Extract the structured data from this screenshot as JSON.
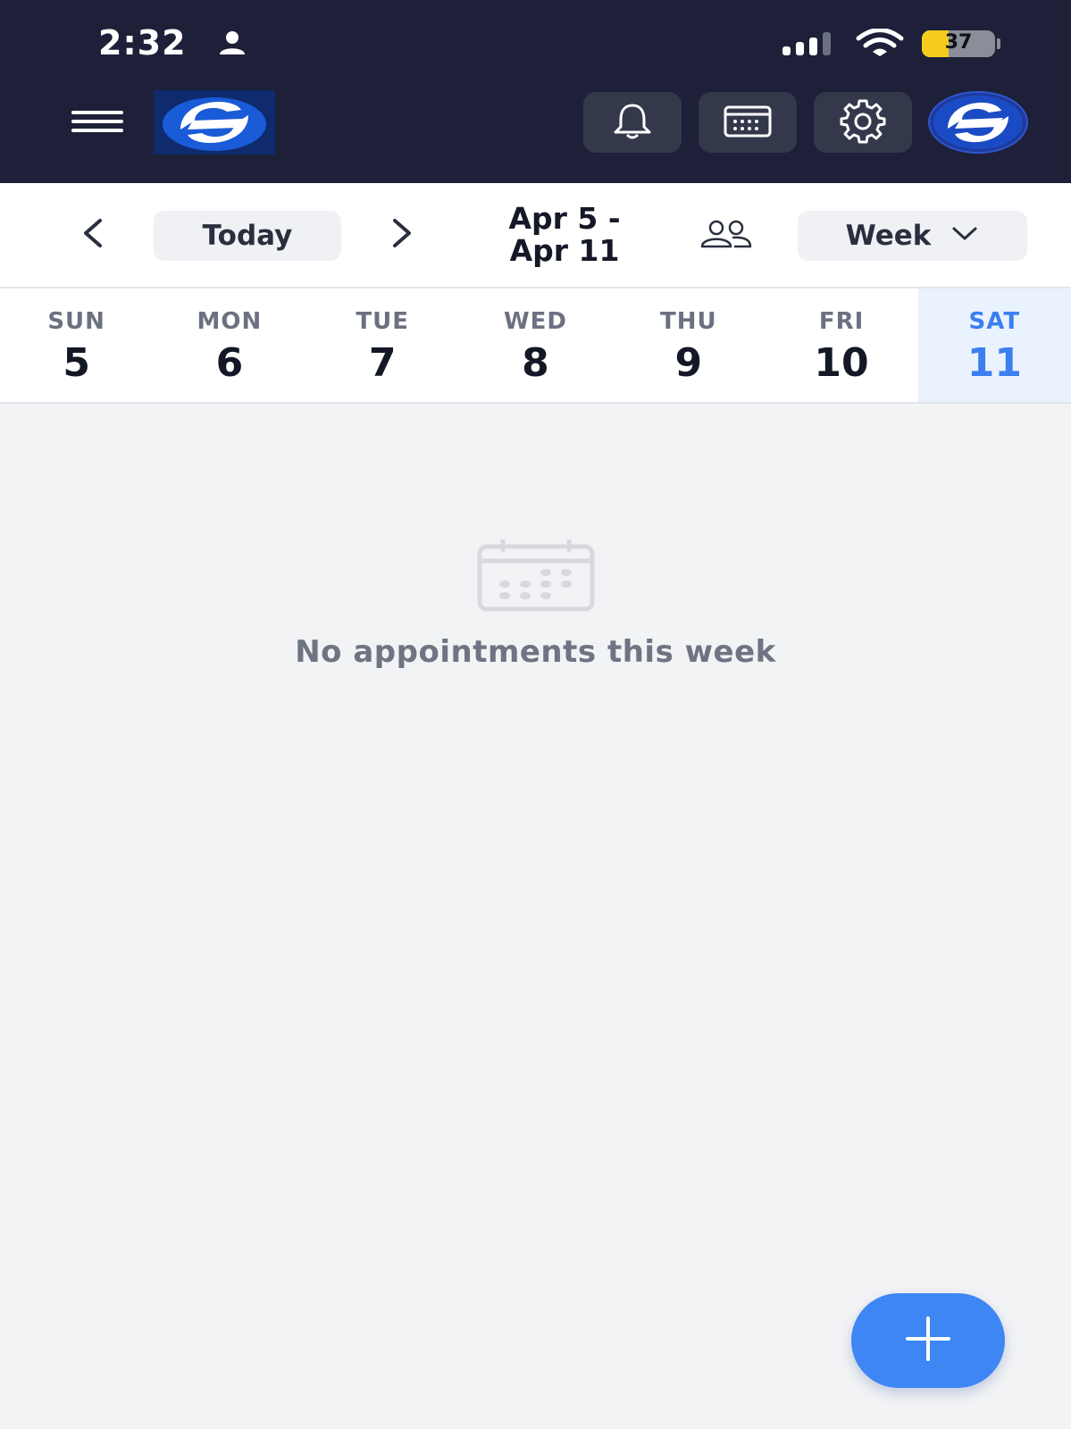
{
  "status_bar": {
    "time": "2:32",
    "battery_level": "37",
    "battery_fraction": 0.37
  },
  "header": {
    "menu_icon": "hamburger-icon",
    "logo_icon": "brand-logo",
    "notifications_icon": "bell-icon",
    "calendar_icon": "calendar-icon",
    "settings_icon": "gear-icon",
    "avatar_icon": "brand-logo"
  },
  "toolbar": {
    "prev_icon": "chevron-left-icon",
    "today_label": "Today",
    "next_icon": "chevron-right-icon",
    "range_line1": "Apr 5 -",
    "range_line2": "Apr 11",
    "staff_icon": "people-icon",
    "view_label": "Week",
    "view_icon": "chevron-down-icon"
  },
  "week": {
    "days": [
      {
        "name": "SUN",
        "num": "5"
      },
      {
        "name": "MON",
        "num": "6"
      },
      {
        "name": "TUE",
        "num": "7"
      },
      {
        "name": "WED",
        "num": "8"
      },
      {
        "name": "THU",
        "num": "9"
      },
      {
        "name": "FRI",
        "num": "10"
      },
      {
        "name": "SAT",
        "num": "11"
      }
    ],
    "selected_index": 6
  },
  "empty_state": {
    "icon": "calendar-icon",
    "message": "No appointments this week"
  },
  "fab": {
    "icon": "plus-icon"
  },
  "colors": {
    "header_bg": "#1d2038",
    "accent": "#3d86f3",
    "selected_day_bg": "#eaf2fe",
    "battery_yellow": "#f6cd1d"
  }
}
